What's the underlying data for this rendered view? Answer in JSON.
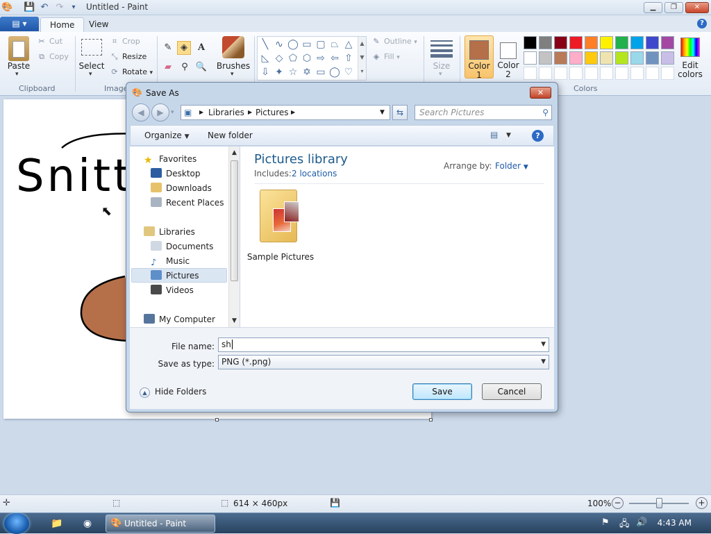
{
  "app": {
    "title": "Untitled - Paint"
  },
  "ribbon": {
    "file_menu": "▤ ▾",
    "tabs": [
      "Home",
      "View"
    ],
    "clipboard": {
      "paste": "Paste",
      "cut": "Cut",
      "copy": "Copy",
      "label": "Clipboard"
    },
    "image": {
      "select": "Select",
      "crop": "Crop",
      "resize": "Resize",
      "rotate": "Rotate",
      "label": "Image"
    },
    "brushes": "Brushes",
    "shapes": {
      "outline": "Outline",
      "fill": "Fill"
    },
    "size": "Size",
    "color1": "Color 1",
    "color2": "Color 2",
    "edit_colors": "Edit colors",
    "colors_label": "Colors",
    "color1_value": "#b5704a",
    "color2_value": "#ffffff",
    "palette_row1": [
      "#000000",
      "#7f7f7f",
      "#880015",
      "#ed1c24",
      "#ff7f27",
      "#fff200",
      "#22b14c",
      "#00a2e8",
      "#3f48cc",
      "#a349a4"
    ],
    "palette_row2": [
      "#ffffff",
      "#c3c3c3",
      "#b97a57",
      "#ffaec9",
      "#ffc90e",
      "#efe4b0",
      "#b5e61d",
      "#99d9ea",
      "#7092be",
      "#c8bfe7"
    ]
  },
  "canvas": {
    "text": "Snitt"
  },
  "dialog": {
    "title": "Save As",
    "breadcrumb": [
      "Libraries",
      "Pictures"
    ],
    "search_placeholder": "Search Pictures",
    "organize": "Organize",
    "new_folder": "New folder",
    "nav": {
      "favorites": "Favorites",
      "desktop": "Desktop",
      "downloads": "Downloads",
      "recent": "Recent Places",
      "libraries": "Libraries",
      "documents": "Documents",
      "music": "Music",
      "pictures": "Pictures",
      "videos": "Videos",
      "computer": "My Computer"
    },
    "library_title": "Pictures library",
    "includes_label": "Includes:",
    "includes_link": "2 locations",
    "arrange_label": "Arrange by:",
    "arrange_value": "Folder",
    "folder_name": "Sample Pictures",
    "file_name_label": "File name:",
    "file_name_value": "sh",
    "save_type_label": "Save as type:",
    "save_type_value": "PNG (*.png)",
    "hide_folders": "Hide Folders",
    "save": "Save",
    "cancel": "Cancel"
  },
  "status": {
    "dimensions": "614 × 460px",
    "zoom": "100%"
  },
  "taskbar": {
    "paint": "Untitled - Paint",
    "time": "4:43 AM"
  }
}
